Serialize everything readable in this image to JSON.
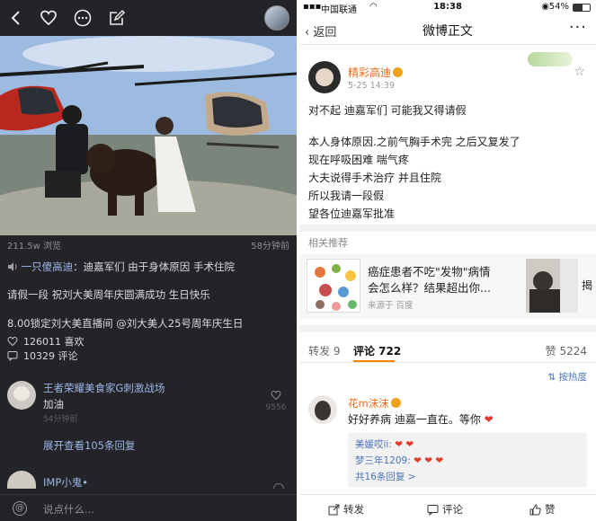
{
  "left": {
    "views": "211.5w 浏览",
    "post_time": "58分钟前",
    "author_name": "一只傻高迪",
    "line1_text": "：迪嘉军们 由于身体原因 手术住院",
    "line2": "请假一段  祝刘大美周年庆圆满成功 生日快乐",
    "line3": "8.00锁定刘大美直播间 @刘大美人25号周年庆生日",
    "likes": "126011 喜欢",
    "comments": "10329 评论",
    "comment1": {
      "name": "王者荣耀美食家G刺激战场",
      "text": "加油",
      "time": "54分钟前",
      "likes": "9556"
    },
    "expand_replies": "展开查看105条回复",
    "comment2_name": "IMP小鬼•",
    "input_placeholder": "说点什么..."
  },
  "right": {
    "carrier": "中国联通",
    "time": "18:38",
    "battery": "54%",
    "back_label": "返回",
    "page_title": "微博正文",
    "author_name": "精彩高迪",
    "post_date": "5-25 14:39",
    "body_lines": [
      "对不起 迪嘉军们 可能我又得请假",
      "本人身体原因.之前气胸手术完 之后又复发了",
      "现在呼吸困难 喘气疼",
      "大夫说得手术治疗 并且住院",
      "所以我请一段假",
      "望各位迪嘉军批准"
    ],
    "related_heading": "相关推荐",
    "related_title_line1": "癌症患者不吃\"发物\"病情",
    "related_title_line2": "会怎么样？结果超出你...",
    "related_source": "来源于 百度",
    "related_cut_text": "揭",
    "tab_reposts": "转发 9",
    "tab_comments": "评论 722",
    "tab_likes": "赞 5224",
    "sort_label": "按热度",
    "comment": {
      "name": "花m沫沫",
      "text": "好好养病 迪嘉一直在。等你"
    },
    "replies": [
      {
        "name": "美媛哎ii:",
        "hearts": "2"
      },
      {
        "name": "梦三年1209:",
        "hearts": "3"
      }
    ],
    "more_replies": "共16条回复 >",
    "bottom_repost": "转发",
    "bottom_comment": "评论",
    "bottom_like": "赞"
  },
  "colors": {
    "left_bg": "#232427",
    "link_blue_dark": "#9fb4e6",
    "name_orange": "#e86b1a",
    "tab_underline": "#ff8200",
    "heart_red": "#e23a2e"
  }
}
